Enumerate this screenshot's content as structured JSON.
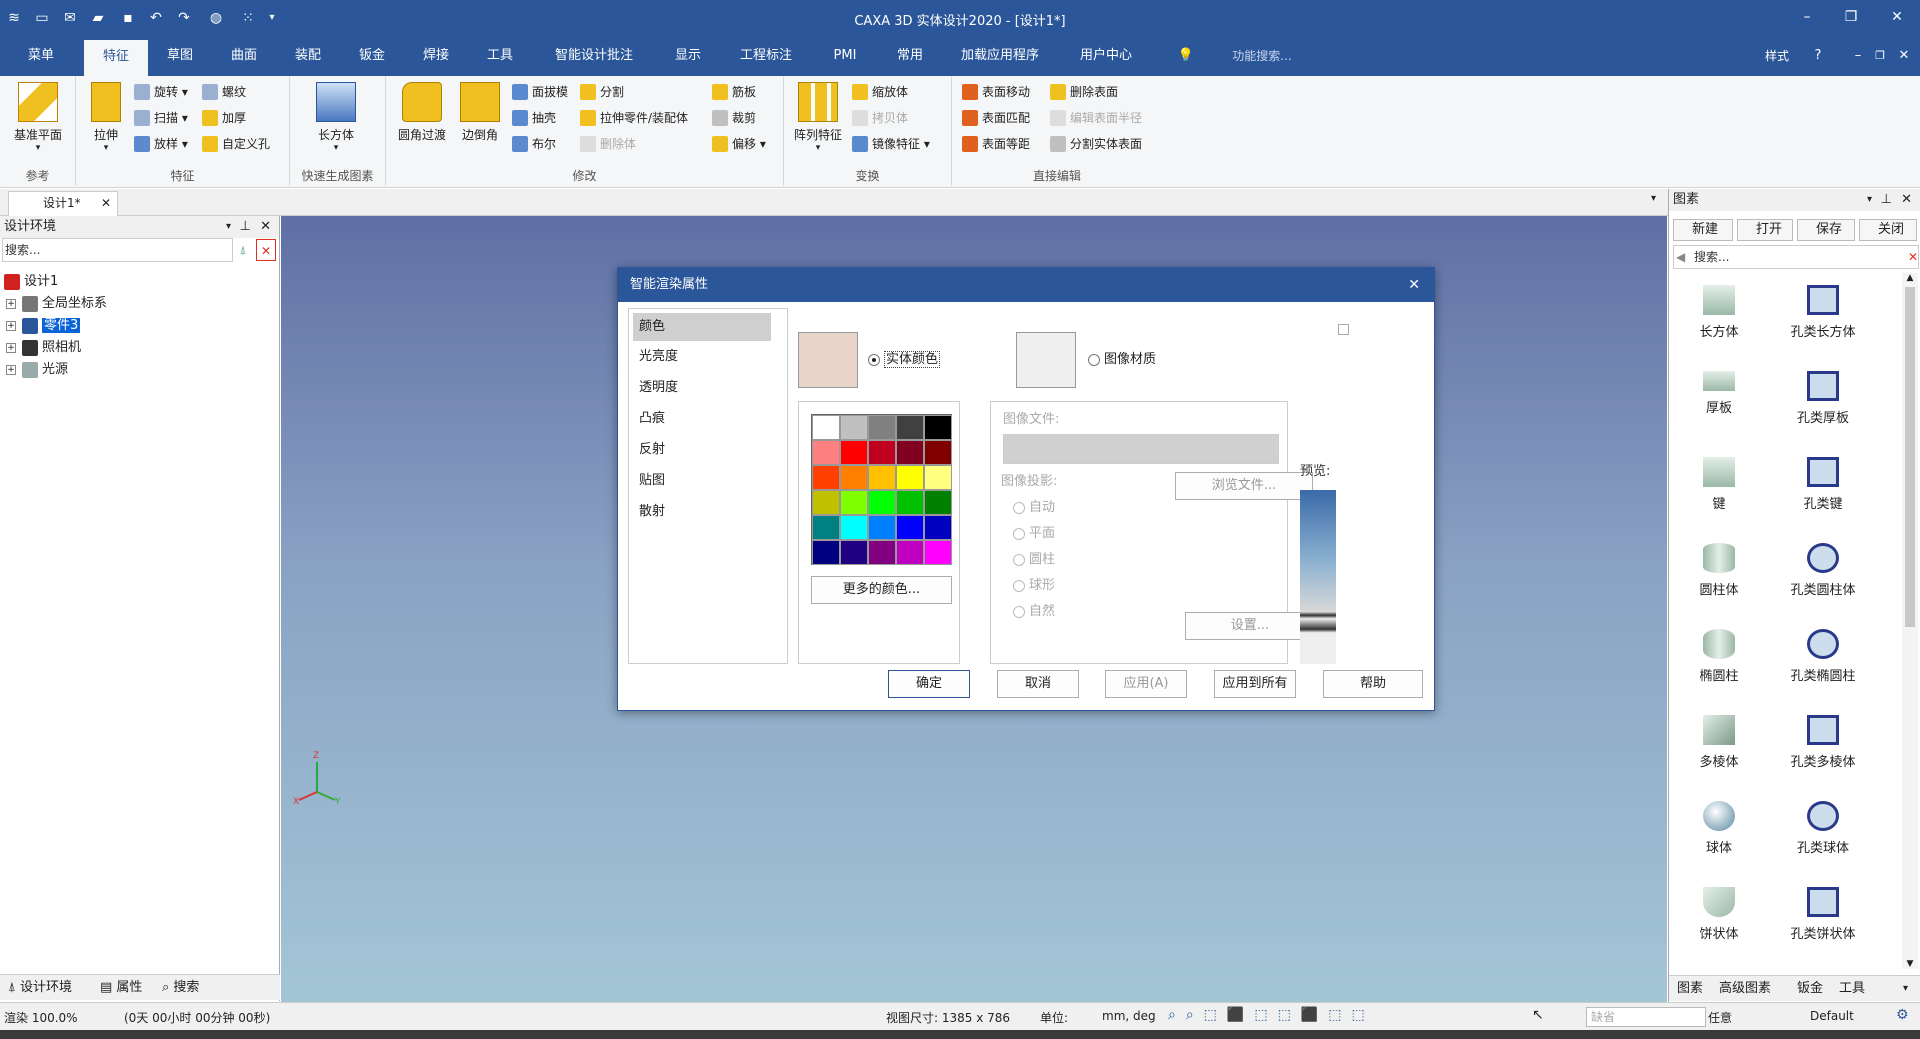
{
  "app": {
    "title": "CAXA 3D 实体设计2020 - [设计1*]"
  },
  "menubar": {
    "tabs": [
      "菜单",
      "特征",
      "草图",
      "曲面",
      "装配",
      "钣金",
      "焊接",
      "工具",
      "智能设计批注",
      "显示",
      "工程标注",
      "PMI",
      "常用",
      "加载应用程序",
      "用户中心"
    ],
    "search_placeholder": "功能搜索...",
    "style_label": "样式"
  },
  "ribbon": {
    "groups": {
      "ref": "参考",
      "feature": "特征",
      "quick": "快速生成图素",
      "modify": "修改",
      "transform": "变换",
      "direct": "直接编辑"
    },
    "ref_plane": "基准平面",
    "extrude": "拉伸",
    "feature_small": [
      "旋转",
      "扫描",
      "放样",
      "螺纹",
      "加厚",
      "自定义孔"
    ],
    "box": "长方体",
    "fillet": "圆角过渡",
    "chamfer": "边倒角",
    "modify_small": [
      "面拔模",
      "抽壳",
      "布尔",
      "分割",
      "拉伸零件/装配体",
      "删除体",
      "筋板",
      "裁剪",
      "偏移"
    ],
    "array": "阵列特征",
    "transform_small": [
      "缩放体",
      "拷贝体",
      "镜像特征"
    ],
    "direct_small": [
      "表面移动",
      "表面匹配",
      "表面等距",
      "删除表面",
      "编辑表面半径",
      "分割实体表面"
    ]
  },
  "doc_tab": "设计1*",
  "left_panel": {
    "title": "设计环境",
    "search": "搜索...",
    "tree": [
      "设计1",
      "全局坐标系",
      "零件3",
      "照相机",
      "光源"
    ],
    "bottom_tabs": [
      "设计环境",
      "属性",
      "搜索"
    ]
  },
  "right_panel": {
    "title": "图素",
    "toolbar": [
      "新建",
      "打开",
      "保存",
      "关闭"
    ],
    "search": "搜索...",
    "items": [
      "长方体",
      "孔类长方体",
      "厚板",
      "孔类厚板",
      "键",
      "孔类键",
      "圆柱体",
      "孔类圆柱体",
      "椭圆柱",
      "孔类椭圆柱",
      "多棱体",
      "孔类多棱体",
      "球体",
      "孔类球体",
      "饼状体",
      "孔类饼状体"
    ],
    "bottom_tabs": [
      "图素",
      "高级图素",
      "钣金",
      "工具"
    ]
  },
  "dialog": {
    "title": "智能渲染属性",
    "nav": [
      "颜色",
      "光亮度",
      "透明度",
      "凸痕",
      "反射",
      "贴图",
      "散射"
    ],
    "solid_color": "实体颜色",
    "image_material": "图像材质",
    "image_file": "图像文件:",
    "browse": "浏览文件...",
    "projection": "图像投影:",
    "proj_options": [
      "自动",
      "平面",
      "圆柱",
      "球形",
      "自然"
    ],
    "settings": "设置...",
    "preview": "预览:",
    "more_colors": "更多的颜色...",
    "buttons": [
      "确定",
      "取消",
      "应用(A)",
      "应用到所有",
      "帮助"
    ],
    "current_color": "#e8d4c8",
    "palette": [
      [
        "#ffffff",
        "#c0c0c0",
        "#808080",
        "#404040",
        "#000000"
      ],
      [
        "#ff8080",
        "#ff0000",
        "#c00020",
        "#800020",
        "#800000"
      ],
      [
        "#ff4000",
        "#ff8000",
        "#ffc000",
        "#ffff00",
        "#ffff80"
      ],
      [
        "#c0c000",
        "#80ff00",
        "#00ff00",
        "#00c000",
        "#008000"
      ],
      [
        "#008080",
        "#00ffff",
        "#0080ff",
        "#0000ff",
        "#0000c0"
      ],
      [
        "#000080",
        "#200080",
        "#800080",
        "#c000c0",
        "#ff00ff"
      ]
    ]
  },
  "status": {
    "render": "渲染 100.0%",
    "time": "(0天 00小时 00分钟 00秒)",
    "view_size": "视图尺寸: 1385 x 786",
    "unit_label": "单位:",
    "unit": "mm, deg",
    "combo1": "任意",
    "combo2": "Default",
    "combo0": "缺省"
  }
}
